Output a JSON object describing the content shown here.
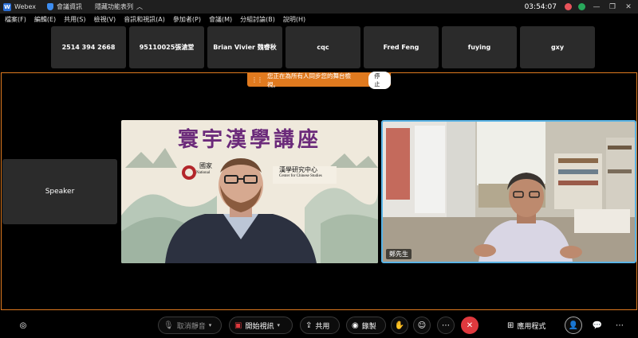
{
  "titlebar": {
    "app_name": "Webex",
    "meeting_info": "會議資訊",
    "hide_menu": "隱藏功能表列",
    "time": "03:54:07"
  },
  "menu": [
    "檔案(F)",
    "編輯(E)",
    "共用(S)",
    "檢視(V)",
    "音訊和視訊(A)",
    "參加者(P)",
    "會議(M)",
    "分組討論(B)",
    "說明(H)"
  ],
  "participants": [
    "2514 394 2668",
    "95110025張滄堂",
    "Brian Vivier 魏睿秋",
    "cqc",
    "Fred Feng",
    "fuying",
    "gxy"
  ],
  "banner": {
    "text": "您正在為所有人同步您的舞台檢視。",
    "stop_label": "停止"
  },
  "speaker_tile": {
    "label": "Speaker"
  },
  "video1": {
    "title": "寰宇漢學講座",
    "institution_zh": "國家",
    "institution_en": "National",
    "center_zh": "漢學研究中心",
    "center_en": "Center for Chinese Studies"
  },
  "video2": {
    "name": "鄭先生"
  },
  "toolbar": {
    "unmute_label": "取消靜音",
    "video_label": "開始視訊",
    "share_label": "共用",
    "record_label": "錄製",
    "apps_label": "應用程式"
  },
  "colors": {
    "accent_orange": "#e07a1f",
    "active_speaker_border": "#5ab4e6",
    "leave_red": "#e0393e",
    "title_purple": "#6b2a7a"
  }
}
